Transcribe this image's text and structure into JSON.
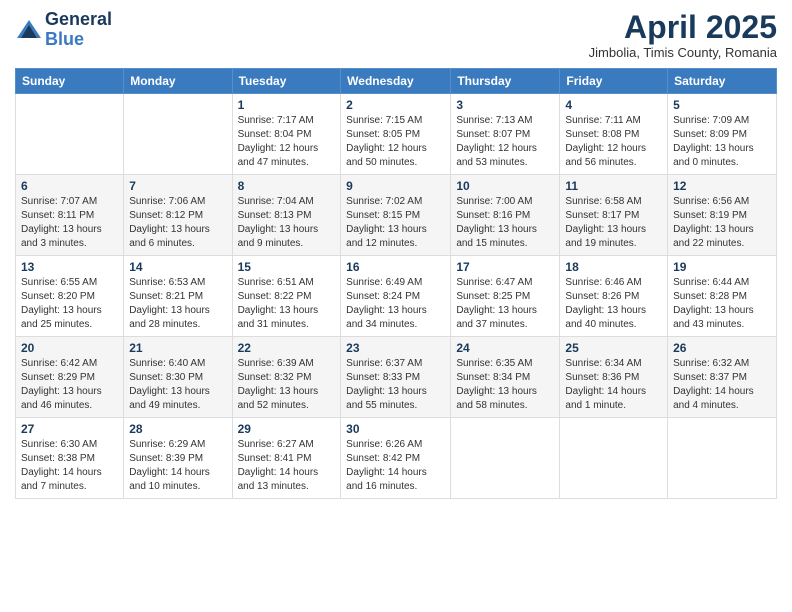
{
  "logo": {
    "general": "General",
    "blue": "Blue"
  },
  "header": {
    "month": "April 2025",
    "location": "Jimbolia, Timis County, Romania"
  },
  "days_of_week": [
    "Sunday",
    "Monday",
    "Tuesday",
    "Wednesday",
    "Thursday",
    "Friday",
    "Saturday"
  ],
  "weeks": [
    [
      {
        "day": "",
        "info": ""
      },
      {
        "day": "",
        "info": ""
      },
      {
        "day": "1",
        "info": "Sunrise: 7:17 AM\nSunset: 8:04 PM\nDaylight: 12 hours and 47 minutes."
      },
      {
        "day": "2",
        "info": "Sunrise: 7:15 AM\nSunset: 8:05 PM\nDaylight: 12 hours and 50 minutes."
      },
      {
        "day": "3",
        "info": "Sunrise: 7:13 AM\nSunset: 8:07 PM\nDaylight: 12 hours and 53 minutes."
      },
      {
        "day": "4",
        "info": "Sunrise: 7:11 AM\nSunset: 8:08 PM\nDaylight: 12 hours and 56 minutes."
      },
      {
        "day": "5",
        "info": "Sunrise: 7:09 AM\nSunset: 8:09 PM\nDaylight: 13 hours and 0 minutes."
      }
    ],
    [
      {
        "day": "6",
        "info": "Sunrise: 7:07 AM\nSunset: 8:11 PM\nDaylight: 13 hours and 3 minutes."
      },
      {
        "day": "7",
        "info": "Sunrise: 7:06 AM\nSunset: 8:12 PM\nDaylight: 13 hours and 6 minutes."
      },
      {
        "day": "8",
        "info": "Sunrise: 7:04 AM\nSunset: 8:13 PM\nDaylight: 13 hours and 9 minutes."
      },
      {
        "day": "9",
        "info": "Sunrise: 7:02 AM\nSunset: 8:15 PM\nDaylight: 13 hours and 12 minutes."
      },
      {
        "day": "10",
        "info": "Sunrise: 7:00 AM\nSunset: 8:16 PM\nDaylight: 13 hours and 15 minutes."
      },
      {
        "day": "11",
        "info": "Sunrise: 6:58 AM\nSunset: 8:17 PM\nDaylight: 13 hours and 19 minutes."
      },
      {
        "day": "12",
        "info": "Sunrise: 6:56 AM\nSunset: 8:19 PM\nDaylight: 13 hours and 22 minutes."
      }
    ],
    [
      {
        "day": "13",
        "info": "Sunrise: 6:55 AM\nSunset: 8:20 PM\nDaylight: 13 hours and 25 minutes."
      },
      {
        "day": "14",
        "info": "Sunrise: 6:53 AM\nSunset: 8:21 PM\nDaylight: 13 hours and 28 minutes."
      },
      {
        "day": "15",
        "info": "Sunrise: 6:51 AM\nSunset: 8:22 PM\nDaylight: 13 hours and 31 minutes."
      },
      {
        "day": "16",
        "info": "Sunrise: 6:49 AM\nSunset: 8:24 PM\nDaylight: 13 hours and 34 minutes."
      },
      {
        "day": "17",
        "info": "Sunrise: 6:47 AM\nSunset: 8:25 PM\nDaylight: 13 hours and 37 minutes."
      },
      {
        "day": "18",
        "info": "Sunrise: 6:46 AM\nSunset: 8:26 PM\nDaylight: 13 hours and 40 minutes."
      },
      {
        "day": "19",
        "info": "Sunrise: 6:44 AM\nSunset: 8:28 PM\nDaylight: 13 hours and 43 minutes."
      }
    ],
    [
      {
        "day": "20",
        "info": "Sunrise: 6:42 AM\nSunset: 8:29 PM\nDaylight: 13 hours and 46 minutes."
      },
      {
        "day": "21",
        "info": "Sunrise: 6:40 AM\nSunset: 8:30 PM\nDaylight: 13 hours and 49 minutes."
      },
      {
        "day": "22",
        "info": "Sunrise: 6:39 AM\nSunset: 8:32 PM\nDaylight: 13 hours and 52 minutes."
      },
      {
        "day": "23",
        "info": "Sunrise: 6:37 AM\nSunset: 8:33 PM\nDaylight: 13 hours and 55 minutes."
      },
      {
        "day": "24",
        "info": "Sunrise: 6:35 AM\nSunset: 8:34 PM\nDaylight: 13 hours and 58 minutes."
      },
      {
        "day": "25",
        "info": "Sunrise: 6:34 AM\nSunset: 8:36 PM\nDaylight: 14 hours and 1 minute."
      },
      {
        "day": "26",
        "info": "Sunrise: 6:32 AM\nSunset: 8:37 PM\nDaylight: 14 hours and 4 minutes."
      }
    ],
    [
      {
        "day": "27",
        "info": "Sunrise: 6:30 AM\nSunset: 8:38 PM\nDaylight: 14 hours and 7 minutes."
      },
      {
        "day": "28",
        "info": "Sunrise: 6:29 AM\nSunset: 8:39 PM\nDaylight: 14 hours and 10 minutes."
      },
      {
        "day": "29",
        "info": "Sunrise: 6:27 AM\nSunset: 8:41 PM\nDaylight: 14 hours and 13 minutes."
      },
      {
        "day": "30",
        "info": "Sunrise: 6:26 AM\nSunset: 8:42 PM\nDaylight: 14 hours and 16 minutes."
      },
      {
        "day": "",
        "info": ""
      },
      {
        "day": "",
        "info": ""
      },
      {
        "day": "",
        "info": ""
      }
    ]
  ]
}
